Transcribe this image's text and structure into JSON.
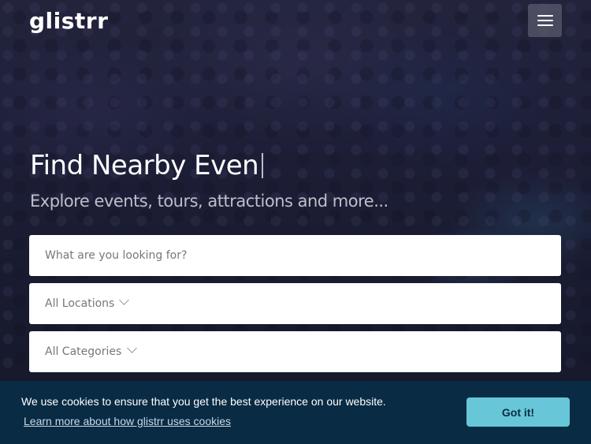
{
  "header": {
    "logo_text": "glistrr",
    "menu_icon": "hamburger-icon"
  },
  "hero": {
    "headline": "Find Nearby Even",
    "subheadline": "Explore events, tours, attractions and more..."
  },
  "search": {
    "keyword_placeholder": "What are you looking for?",
    "location_selected": "All Locations",
    "category_selected": "All Categories",
    "dropdown_icon": "chevron-down-icon"
  },
  "cookie_banner": {
    "message": "We use cookies to ensure that you get the best experience on our website.",
    "learn_more_link": "Learn more about how glistrr uses cookies",
    "accept_label": "Got it!",
    "background_color": "#092b44",
    "button_color": "#67c7d8"
  }
}
